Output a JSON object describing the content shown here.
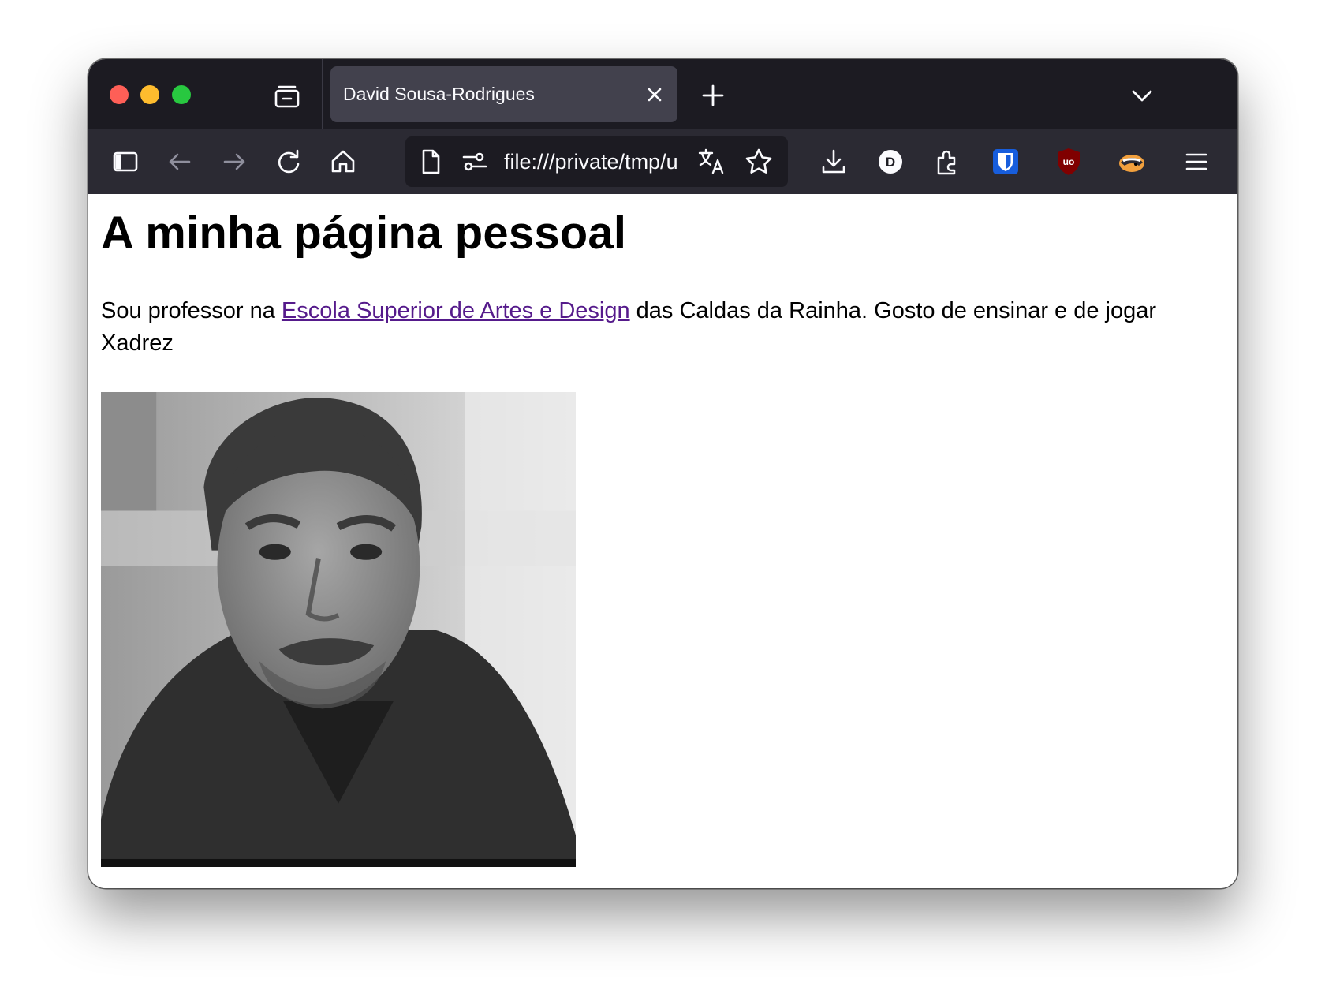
{
  "browser": {
    "tab": {
      "title": "David Sousa-Rodrigues"
    },
    "urlbar": {
      "url": "file:///private/tmp/u"
    },
    "toolbar_icons": [
      "sidebar-icon",
      "back-arrow-icon",
      "forward-arrow-icon",
      "reload-icon",
      "home-icon",
      "download-icon",
      "extension-d-icon",
      "extensions-puzzle-icon",
      "bitwarden-icon",
      "ublock-origin-icon",
      "privacy-badger-icon",
      "menu-icon"
    ]
  },
  "page": {
    "heading": "A minha página pessoal",
    "paragraph": {
      "before_link": "Sou professor na ",
      "link_text": "Escola Superior de Artes e Design",
      "after_link": " das Caldas da Rainha. Gosto de ensinar e de jogar Xadrez"
    },
    "photo": {
      "description_icon": "portrait-photo",
      "style": "grayscale"
    }
  },
  "colors": {
    "tabbar_bg": "#1c1b22",
    "navbar_bg": "#2b2a33",
    "active_tab": "#42414d",
    "link_visited": "#551a8b"
  }
}
